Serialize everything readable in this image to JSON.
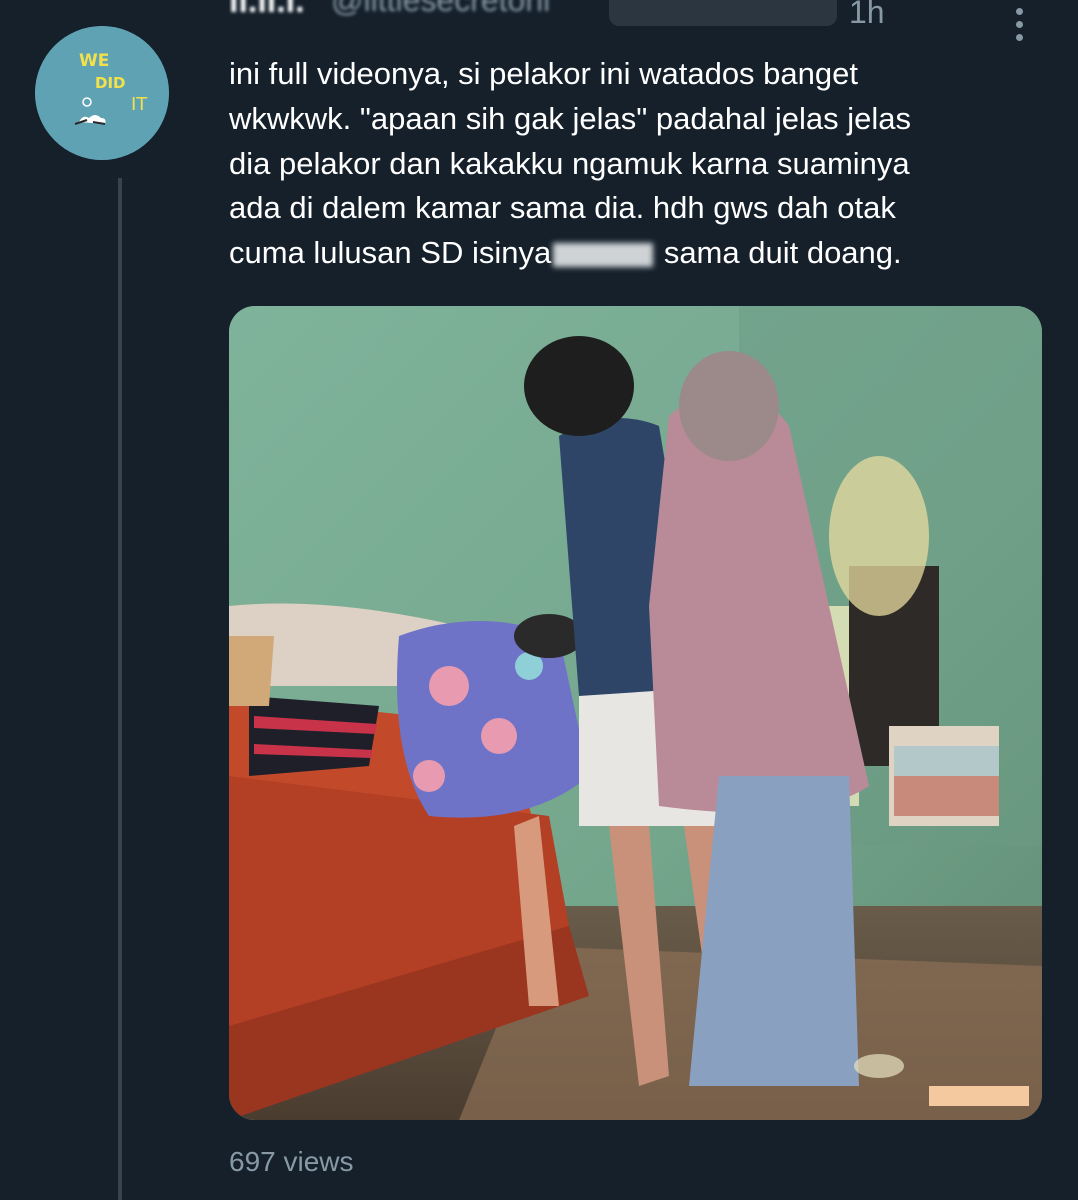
{
  "author": {
    "name": "li.li.l.",
    "handle": "@littlesecretoni"
  },
  "timestamp": "1h",
  "tweet": {
    "line1": "ini full videonya, si pelakor ini watados banget",
    "line2": "wkwkwk. \"apaan sih gak jelas\" padahal jelas jelas",
    "line3": "dia pelakor dan kakakku ngamuk karna suaminya",
    "line4": "ada di dalem kamar sama dia. hdh gws dah otak",
    "line5_before": "cuma lulusan SD isinya",
    "line5_after": " sama duit doang."
  },
  "avatar_text": {
    "we": "WE",
    "did": "DID",
    "it": "IT"
  },
  "views": "697 views",
  "colors": {
    "background": "#15202b",
    "secondary_text": "#8899a6",
    "thread_line": "#38444d",
    "avatar_bg": "#5fa2b4",
    "avatar_text": "#f2e14b"
  },
  "icons": {
    "more": "more-vertical-icon"
  }
}
